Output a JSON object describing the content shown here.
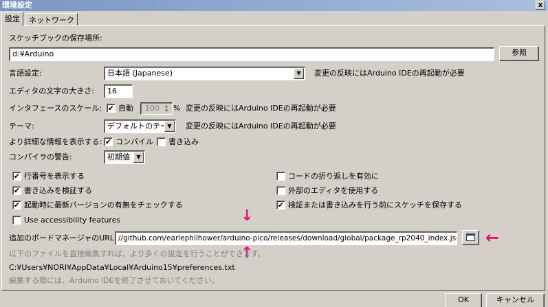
{
  "window": {
    "title": "環境設定",
    "close_glyph": "x"
  },
  "tabs": [
    {
      "label": "設定"
    },
    {
      "label": "ネットワーク"
    }
  ],
  "sketchbook": {
    "label": "スケッチブックの保存場所:",
    "value": "d:¥Arduino",
    "browse_label": "参照"
  },
  "language": {
    "label": "言語設定:",
    "value": "日本語 (Japanese)",
    "note": "変更の反映にはArduino IDEの再起動が必要"
  },
  "font_size": {
    "label": "エディタの文字の大きさ:",
    "value": "16"
  },
  "scale": {
    "label": "インタフェースのスケール:",
    "auto_label": "自動",
    "auto_checked": true,
    "value": "100",
    "unit": "%",
    "note": "変更の反映にはArduino IDEの再起動が必要"
  },
  "theme": {
    "label": "テーマ:",
    "value": "デフォルトのテーマ",
    "note": "変更の反映にはArduino IDEの再起動が必要"
  },
  "verbose": {
    "label": "より詳細な情報を表示する:",
    "compile_label": "コンパイル",
    "compile_checked": true,
    "upload_label": "書き込み",
    "upload_checked": false
  },
  "warnings": {
    "label": "コンパイラの警告:",
    "value": "初期値"
  },
  "options_left": [
    {
      "label": "行番号を表示する",
      "checked": true
    },
    {
      "label": "書き込みを検証する",
      "checked": true
    },
    {
      "label": "起動時に最新バージョンの有無をチェックする",
      "checked": true
    },
    {
      "label": "Use accessibility features",
      "checked": false
    }
  ],
  "options_right": [
    {
      "label": "コードの折り返しを有効に",
      "checked": false
    },
    {
      "label": "外部のエディタを使用する",
      "checked": false
    },
    {
      "label": "検証または書き込みを行う前にスケッチを保存する",
      "checked": true
    }
  ],
  "boards_url": {
    "label": "追加のボードマネージャのURL:",
    "value": "//github.com/earlephilhower/arduino-pico/releases/download/global/package_rp2040_index.json"
  },
  "info": {
    "hint": "以下のファイルを直接編集すれば、より多くの設定を行うことができます。",
    "path": "C:¥Users¥NORI¥AppData¥Local¥Arduino15¥preferences.txt",
    "note": "編集する際には、Arduino IDEを終了させておいてください。"
  },
  "annotations": {
    "arrow_down": "↓",
    "arrow_up": "↑",
    "arrow_left": "←",
    "color": "#e8107a"
  },
  "footer": {
    "ok_label": "OK",
    "cancel_label": "キャンセル"
  }
}
